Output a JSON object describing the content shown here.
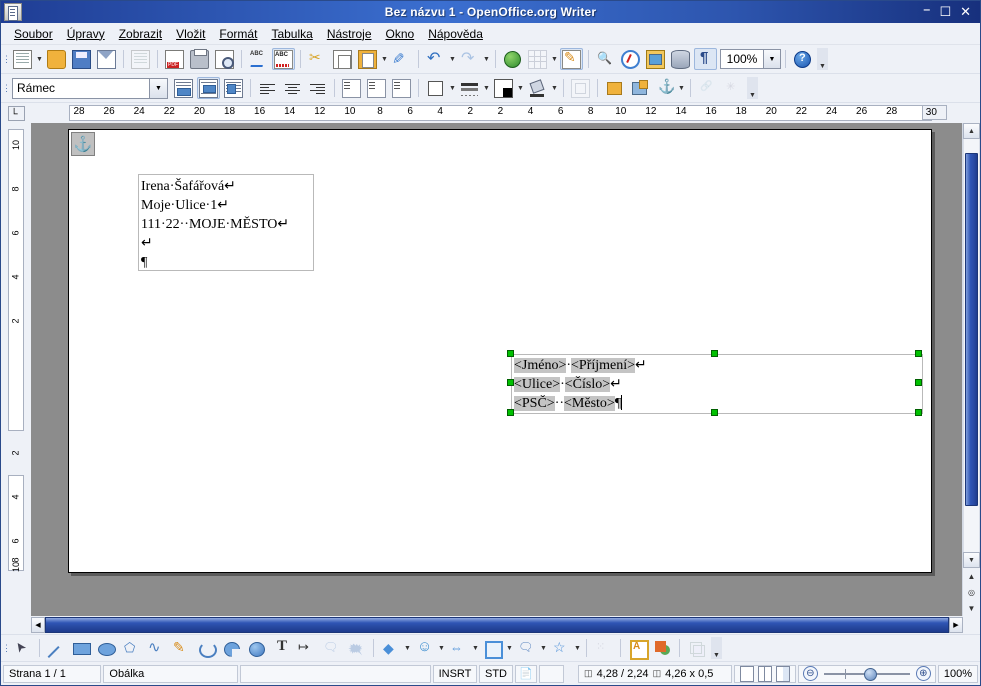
{
  "window": {
    "title": "Bez názvu 1 - OpenOffice.org Writer",
    "minimize": "–",
    "maximize": "☐",
    "close": "✕",
    "app_icon": "writer-document-icon"
  },
  "menubar": [
    {
      "label": "Soubor"
    },
    {
      "label": "Úpravy"
    },
    {
      "label": "Zobrazit"
    },
    {
      "label": "Vložit"
    },
    {
      "label": "Formát"
    },
    {
      "label": "Tabulka"
    },
    {
      "label": "Nástroje"
    },
    {
      "label": "Okno"
    },
    {
      "label": "Nápověda"
    }
  ],
  "standard_toolbar": {
    "zoom_value": "100%",
    "buttons": [
      {
        "name": "new-document",
        "icon": "new-document-icon"
      },
      {
        "name": "open",
        "icon": "open-folder-icon"
      },
      {
        "name": "save",
        "icon": "floppy-disk-icon"
      },
      {
        "name": "email-document",
        "icon": "envelope-icon"
      },
      {
        "name": "edit-file",
        "icon": "edit-file-icon"
      },
      {
        "name": "export-pdf",
        "icon": "pdf-icon"
      },
      {
        "name": "print",
        "icon": "printer-icon"
      },
      {
        "name": "print-preview",
        "icon": "magnifier-page-icon"
      },
      {
        "name": "spelling",
        "icon": "abc-check-icon"
      },
      {
        "name": "autospellcheck",
        "icon": "abc-squiggle-icon"
      },
      {
        "name": "cut",
        "icon": "scissors-icon"
      },
      {
        "name": "copy",
        "icon": "copy-icon"
      },
      {
        "name": "paste",
        "icon": "clipboard-icon"
      },
      {
        "name": "clone-formatting",
        "icon": "paintbrush-icon"
      },
      {
        "name": "undo",
        "icon": "undo-arrow-icon"
      },
      {
        "name": "redo",
        "icon": "redo-arrow-icon"
      },
      {
        "name": "hyperlink",
        "icon": "globe-icon"
      },
      {
        "name": "insert-table",
        "icon": "table-grid-icon"
      },
      {
        "name": "edit-mode",
        "icon": "pencil-page-icon"
      },
      {
        "name": "find-replace",
        "icon": "binoculars-icon"
      },
      {
        "name": "navigator",
        "icon": "compass-icon"
      },
      {
        "name": "gallery",
        "icon": "picture-frame-icon"
      },
      {
        "name": "data-sources",
        "icon": "database-icon"
      },
      {
        "name": "formatting-marks",
        "icon": "pilcrow-icon"
      },
      {
        "name": "help",
        "icon": "help-circle-icon"
      }
    ]
  },
  "frame_toolbar": {
    "style_value": "Rámec",
    "buttons": [
      {
        "name": "wrap-off",
        "icon": "wrap-off-icon"
      },
      {
        "name": "wrap-on",
        "icon": "wrap-page-icon"
      },
      {
        "name": "wrap-through",
        "icon": "wrap-through-icon"
      },
      {
        "name": "align-left",
        "icon": "align-left-icon"
      },
      {
        "name": "align-center",
        "icon": "align-center-icon"
      },
      {
        "name": "align-right",
        "icon": "align-right-icon"
      },
      {
        "name": "align-top",
        "icon": "align-top-icon"
      },
      {
        "name": "align-middle",
        "icon": "align-middle-icon"
      },
      {
        "name": "align-bottom",
        "icon": "align-bottom-icon"
      },
      {
        "name": "border-style",
        "icon": "border-square-icon"
      },
      {
        "name": "line-style",
        "icon": "line-style-icon"
      },
      {
        "name": "line-color",
        "icon": "line-color-icon"
      },
      {
        "name": "background-color",
        "icon": "paint-bucket-icon"
      },
      {
        "name": "frame-properties",
        "icon": "frame-properties-icon"
      },
      {
        "name": "bring-to-front",
        "icon": "bring-front-icon"
      },
      {
        "name": "send-to-back",
        "icon": "send-back-icon"
      },
      {
        "name": "change-anchor",
        "icon": "anchor-icon"
      },
      {
        "name": "link-frames",
        "icon": "chain-link-icon"
      },
      {
        "name": "unlink-frames",
        "icon": "break-link-icon"
      }
    ]
  },
  "ruler": {
    "horizontal_left": [
      "28",
      "26",
      "24",
      "22",
      "20",
      "18",
      "16",
      "14",
      "12",
      "10",
      "8",
      "6",
      "4",
      "2"
    ],
    "horizontal_right": [
      "2",
      "4",
      "6",
      "8",
      "10",
      "12",
      "14",
      "16",
      "18",
      "20",
      "22",
      "24",
      "26",
      "28"
    ],
    "horizontal_outside": "30",
    "vertical": [
      "10",
      "8",
      "6",
      "4",
      "2",
      "2",
      "4",
      "6",
      "8",
      "10"
    ],
    "corner_icon": "tab-stop-icon"
  },
  "document": {
    "anchor_icon": "anchor-icon",
    "sender_frame": {
      "lines": [
        {
          "text": "Irena·Šafářová",
          "mark": "↵"
        },
        {
          "text": "Moje·Ulice·1",
          "mark": "↵"
        },
        {
          "text": "111·22··MOJE·MĚSTO",
          "mark": "↵"
        },
        {
          "text": "",
          "mark": "↵"
        },
        {
          "text": "",
          "mark": "¶"
        }
      ]
    },
    "recipient_frame": {
      "selected": true,
      "lines": [
        {
          "field1": "<Jméno>",
          "sep": "·",
          "field2": "<Příjmení>",
          "mark": "↵"
        },
        {
          "field1": "<Ulice>",
          "sep": "·",
          "field2": "<Číslo>",
          "mark": "↵"
        },
        {
          "field1": "<PSČ>",
          "sep": "··",
          "field2": "<Město>",
          "mark": "¶"
        }
      ],
      "handle_color": "#00c000"
    }
  },
  "drawing_toolbar": [
    {
      "name": "select",
      "icon": "arrow-pointer-icon"
    },
    {
      "name": "line",
      "icon": "line-icon"
    },
    {
      "name": "rectangle",
      "icon": "rectangle-icon"
    },
    {
      "name": "ellipse",
      "icon": "ellipse-icon"
    },
    {
      "name": "polygon",
      "icon": "polygon-icon"
    },
    {
      "name": "curve",
      "icon": "curve-icon"
    },
    {
      "name": "freeform-line",
      "icon": "freeform-pencil-icon"
    },
    {
      "name": "arc",
      "icon": "arc-icon"
    },
    {
      "name": "ellipse-pie",
      "icon": "pie-icon"
    },
    {
      "name": "circle-segment",
      "icon": "circle-segment-icon"
    },
    {
      "name": "text-box",
      "icon": "text-t-icon"
    },
    {
      "name": "callouts-dimension",
      "icon": "dimension-line-icon"
    },
    {
      "name": "callout",
      "icon": "callout-bubble-icon"
    },
    {
      "name": "vertical-callout",
      "icon": "vertical-callout-icon"
    },
    {
      "name": "basic-shapes",
      "icon": "diamond-shape-icon"
    },
    {
      "name": "symbol-shapes",
      "icon": "smiley-face-icon"
    },
    {
      "name": "block-arrows",
      "icon": "double-arrow-icon"
    },
    {
      "name": "flowchart",
      "icon": "flowchart-icon"
    },
    {
      "name": "callout-shapes",
      "icon": "speech-bubble-icon"
    },
    {
      "name": "stars",
      "icon": "star-icon"
    },
    {
      "name": "points",
      "icon": "edit-points-icon"
    },
    {
      "name": "fontwork",
      "icon": "fontwork-icon"
    },
    {
      "name": "from-file",
      "icon": "image-from-file-icon"
    },
    {
      "name": "extrusion",
      "icon": "extrusion-3d-icon"
    }
  ],
  "statusbar": {
    "page": "Strana 1 / 1",
    "page_style": "Obálka",
    "blank": "",
    "insert_mode": "INSRT",
    "selection_mode": "STD",
    "modified_icon": "document-modified-icon",
    "signature": "",
    "position": "4,28 / 2,24",
    "size": "4,26 x 0,5",
    "position_icon": "cursor-position-icon",
    "size_icon": "object-size-icon",
    "view_single": "single-page-view-icon",
    "view_multi": "multi-page-view-icon",
    "view_book": "book-view-icon",
    "zoom_out": "⊖",
    "zoom_in": "⊕",
    "zoom_value": "100%"
  },
  "scrollbars": {
    "v_up": "▲",
    "v_down": "▼",
    "nav_prev": "▲",
    "nav_select": "◎",
    "nav_next": "▼",
    "h_left": "◀",
    "h_right": "▶"
  },
  "colors": {
    "title_bar": "#2a4a8a",
    "toolbar_bg": "#eef1f7",
    "canvas_bg": "#8c8c8c",
    "scroll_thumb": "#2f55b5",
    "field_shading": "#c4c4c4",
    "handle_green": "#00c000"
  }
}
